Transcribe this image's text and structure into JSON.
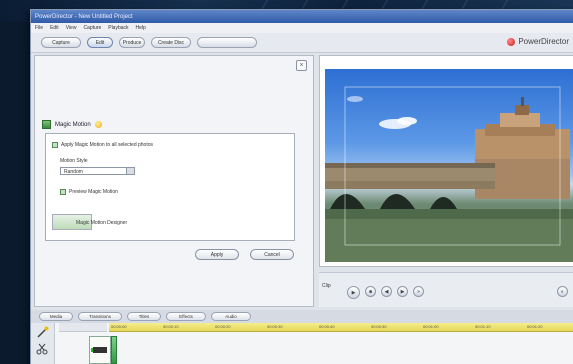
{
  "window": {
    "title": "PowerDirector - New Untitled Project"
  },
  "menu": [
    "File",
    "Edit",
    "View",
    "Capture",
    "Playback",
    "Help"
  ],
  "toolbar": {
    "buttons": [
      "Capture",
      "Edit",
      "Produce",
      "Create Disc",
      ""
    ],
    "active": "Edit"
  },
  "brand": {
    "name": "PowerDirector",
    "accent": "#cc1a1a"
  },
  "left_panel": {
    "heading": "Magic Motion",
    "option_apply": "Apply Magic Motion to all selected photos",
    "motion_style_label": "Motion Style",
    "motion_style_value": "Random",
    "option_preview": "Preview Magic Motion",
    "thumb_label": "Magic Motion Designer",
    "apply_button": "Apply",
    "close_glyph": "×",
    "cancel_button": "Cancel"
  },
  "player": {
    "controls": [
      "play",
      "stop",
      "prev",
      "next",
      "fast"
    ],
    "mode_label": "Clip"
  },
  "bottom_tabs": [
    "Media",
    "Transitions",
    "Titles",
    "Effects",
    "Audio"
  ],
  "timeline": {
    "ruler_marks": [
      "00:00:00",
      "00:00:10",
      "00:00:20",
      "00:00:30",
      "00:00:40",
      "00:00:50",
      "00:01:00",
      "00:01:10",
      "00:01:20"
    ]
  },
  "colors": {
    "title_bar": "#2f5aa6",
    "ruler": "#e5d85a",
    "clip_tab": "#2f9a42"
  }
}
